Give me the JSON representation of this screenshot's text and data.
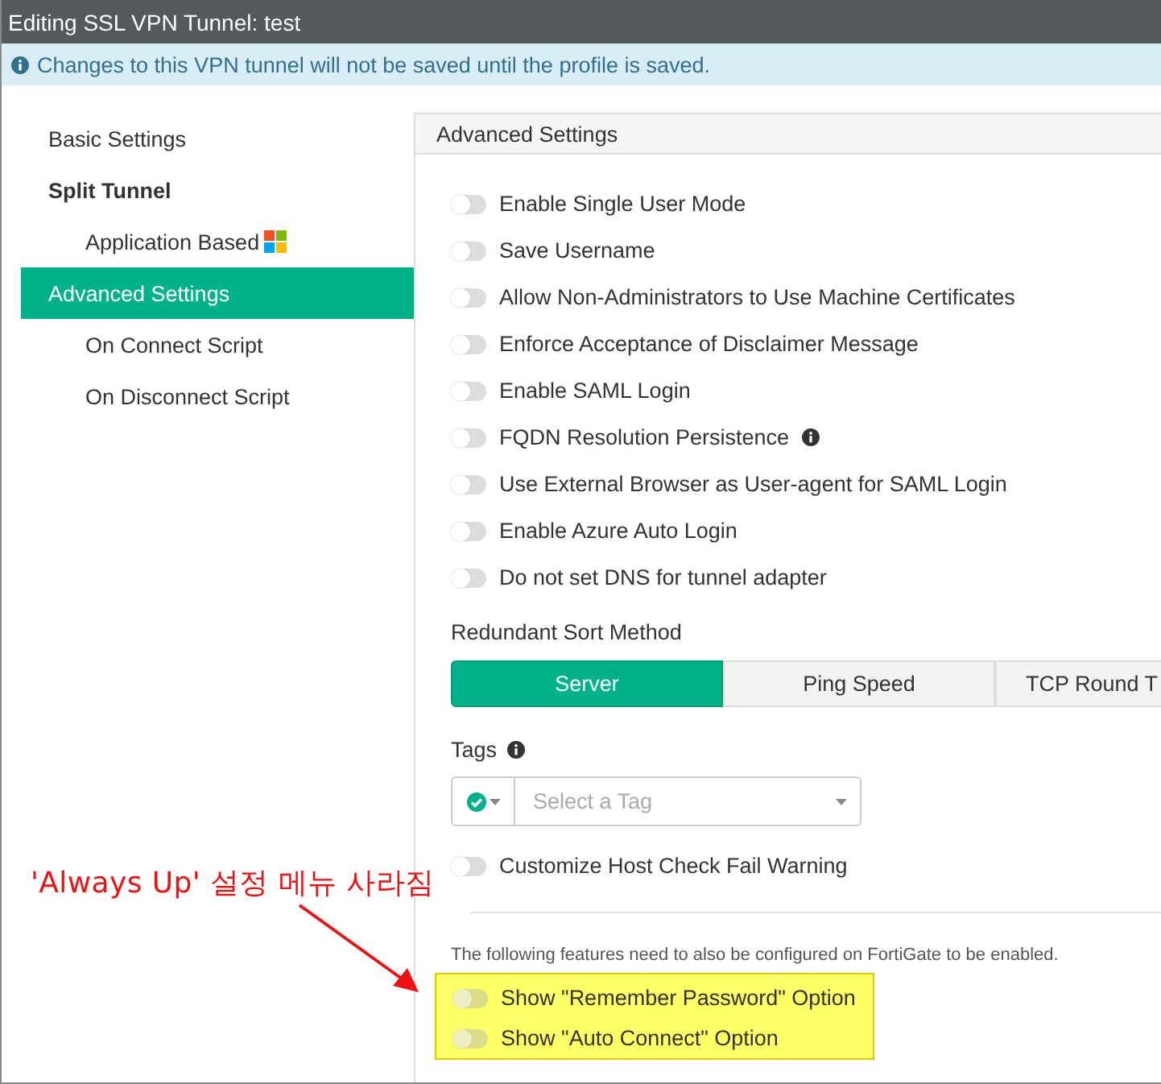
{
  "window": {
    "title": "Editing SSL VPN Tunnel: test"
  },
  "info_bar": {
    "text": "Changes to this VPN tunnel will not be saved until the profile is saved."
  },
  "sidebar": {
    "items": [
      {
        "label": "Basic Settings",
        "kind": "link",
        "selected": false
      },
      {
        "label": "Split Tunnel",
        "kind": "heading",
        "selected": false
      },
      {
        "label": "Application Based",
        "kind": "sub-windows",
        "selected": false
      },
      {
        "label": "Advanced Settings",
        "kind": "link",
        "selected": true
      },
      {
        "label": "On Connect Script",
        "kind": "sub",
        "selected": false
      },
      {
        "label": "On Disconnect Script",
        "kind": "sub",
        "selected": false
      }
    ]
  },
  "panel": {
    "title": "Advanced Settings",
    "toggles": [
      {
        "label": "Enable Single User Mode",
        "on": false,
        "info": false
      },
      {
        "label": "Save Username",
        "on": false,
        "info": false
      },
      {
        "label": "Allow Non-Administrators to Use Machine Certificates",
        "on": false,
        "info": false
      },
      {
        "label": "Enforce Acceptance of Disclaimer Message",
        "on": false,
        "info": false
      },
      {
        "label": "Enable SAML Login",
        "on": false,
        "info": false
      },
      {
        "label": "FQDN Resolution Persistence",
        "on": false,
        "info": true
      },
      {
        "label": "Use External Browser as User-agent for SAML Login",
        "on": false,
        "info": false
      },
      {
        "label": "Enable Azure Auto Login",
        "on": false,
        "info": false
      },
      {
        "label": "Do not set DNS for tunnel adapter",
        "on": false,
        "info": false
      }
    ],
    "sort_method": {
      "label": "Redundant Sort Method",
      "options": [
        {
          "label": "Server",
          "selected": true
        },
        {
          "label": "Ping Speed",
          "selected": false
        },
        {
          "label": "TCP Round T",
          "selected": false
        }
      ]
    },
    "tags": {
      "label": "Tags",
      "placeholder": "Select a Tag"
    },
    "host_check": {
      "label": "Customize Host Check Fail Warning",
      "on": false
    },
    "fortigate_note": "The following features need to also be configured on FortiGate to be enabled.",
    "fortigate_options": [
      {
        "label": "Show \"Remember Password\" Option",
        "on": false
      },
      {
        "label": "Show \"Auto Connect\" Option",
        "on": false
      }
    ]
  },
  "annotation": {
    "text": "'Always Up' 설정 메뉴 사라짐"
  }
}
